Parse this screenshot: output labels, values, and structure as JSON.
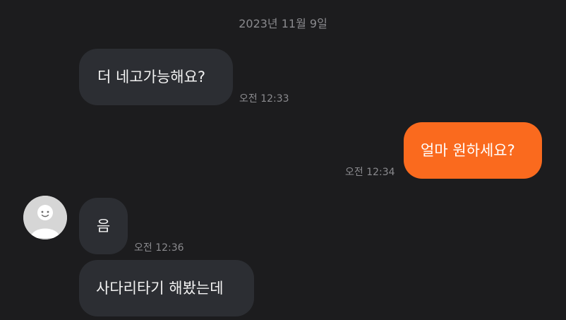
{
  "date_divider": "2023년 11월 9일",
  "messages": [
    {
      "direction": "incoming",
      "text": "더 네고가능해요?",
      "time": "오전 12:33"
    },
    {
      "direction": "outgoing",
      "text": "얼마 원하세요?",
      "time": "오전 12:34"
    },
    {
      "direction": "incoming",
      "text": "음",
      "time": "오전 12:36"
    },
    {
      "direction": "incoming",
      "text": "사다리타기 해봤는데",
      "time": ""
    }
  ],
  "colors": {
    "background": "#1c1c1e",
    "incoming_bubble": "#2c2e33",
    "outgoing_bubble": "#fa6a1e",
    "timestamp": "#8a8a8e"
  },
  "icons": {
    "avatar": "default-profile-avatar-icon"
  }
}
